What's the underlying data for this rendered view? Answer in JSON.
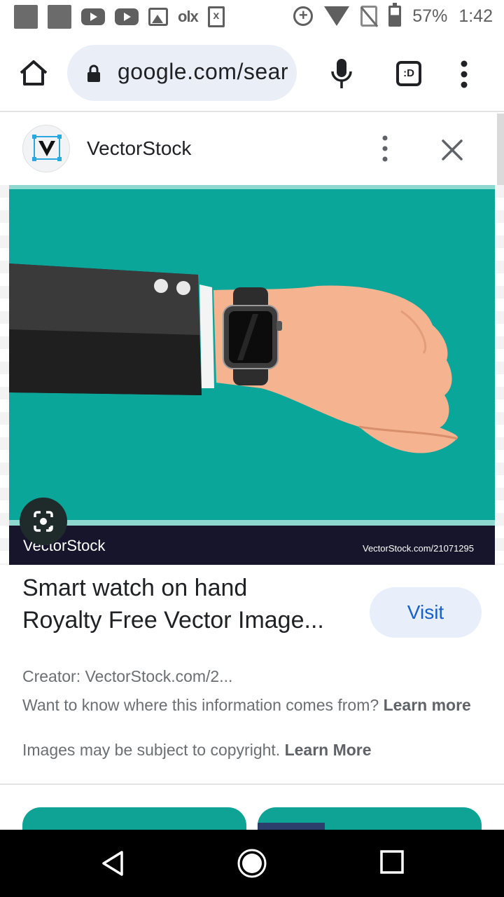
{
  "status_bar": {
    "battery": "57%",
    "time": "1:42",
    "olx_label": "olx",
    "doc_label": "x",
    "icons": [
      "app-icon",
      "app-icon",
      "youtube-icon",
      "youtube-icon",
      "gallery-icon",
      "olx-icon",
      "document-icon",
      "data-saver-icon",
      "wifi-icon",
      "no-sim-icon",
      "battery-icon"
    ]
  },
  "browser": {
    "url": "google.com/sear",
    "tabs_label": ":D",
    "icons": [
      "home-icon",
      "lock-icon",
      "mic-icon",
      "tabs-icon",
      "menu-icon"
    ]
  },
  "card": {
    "site_name": "VectorStock",
    "logo_letter": "V",
    "image": {
      "watermark_left": "VectorStock",
      "watermark_right": "VectorStock.com/21071295",
      "accent": "#0aa69a"
    },
    "title_line1": "Smart watch on hand",
    "title_line2": "Royalty Free Vector Image...",
    "visit_label": "Visit",
    "creator": "Creator: VectorStock.com/2...",
    "info_text": "Want to know where this information comes from?",
    "info_link": "Learn more",
    "copyright_text": "Images may be subject to copyright.",
    "copyright_link": "Learn More"
  },
  "nav": {
    "icons": [
      "back-icon",
      "home-circle-icon",
      "recents-icon"
    ]
  },
  "colors": {
    "teal": "#0aa69a",
    "visit_bg": "#e8effb",
    "visit_text": "#1a5fc8",
    "dark_band": "#16152b"
  }
}
